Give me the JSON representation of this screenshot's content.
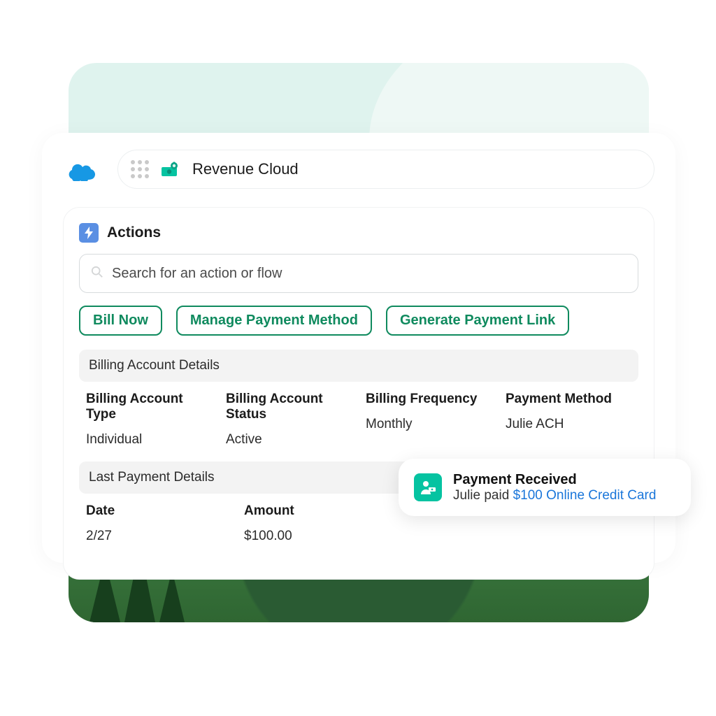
{
  "colors": {
    "brand_green": "#0f8a5e",
    "sf_blue": "#1798c1",
    "accent_teal": "#05c3a1",
    "link_blue": "#1a76da"
  },
  "header": {
    "app_title": "Revenue Cloud"
  },
  "actions_panel": {
    "title": "Actions",
    "search_placeholder": "Search for an action or flow",
    "buttons": {
      "bill_now": "Bill Now",
      "manage_payment_method": "Manage Payment Method",
      "generate_payment_link": "Generate Payment Link"
    }
  },
  "billing_details": {
    "section_title": "Billing Account Details",
    "columns": {
      "type": {
        "label": "Billing Account Type",
        "value": "Individual"
      },
      "status": {
        "label": "Billing Account Status",
        "value": "Active"
      },
      "freq": {
        "label": "Billing Frequency",
        "value": "Monthly"
      },
      "method": {
        "label": "Payment Method",
        "value": "Julie ACH"
      }
    }
  },
  "last_payment": {
    "section_title": "Last Payment Details",
    "columns": {
      "date": {
        "label": "Date",
        "value": "2/27"
      },
      "amount": {
        "label": "Amount",
        "value": "$100.00"
      }
    }
  },
  "toast": {
    "title": "Payment Received",
    "prefix": "Julie paid ",
    "link_text": "$100 Online Credit Card"
  }
}
